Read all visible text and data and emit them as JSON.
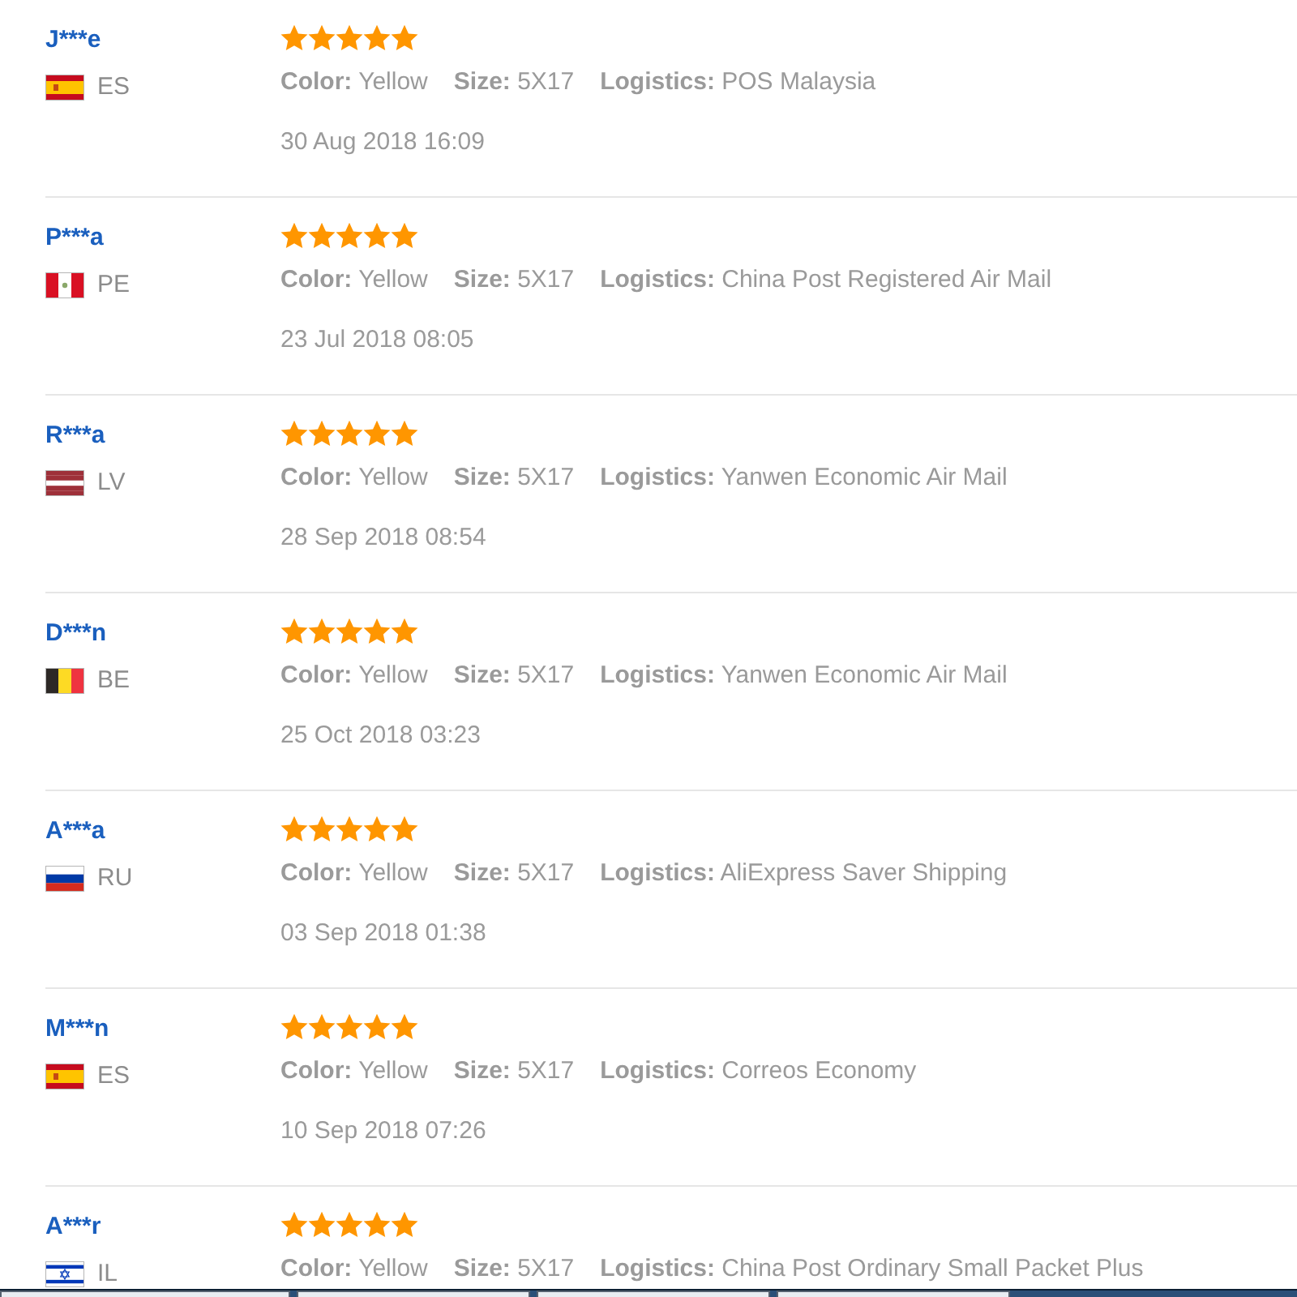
{
  "reviews": [
    {
      "name": "J***e",
      "country": "ES",
      "flag": {
        "kind": "spain"
      },
      "stars": 5,
      "attributes": [
        "**Color:** Yellow",
        "**Size:** 5X17",
        "**Logistics:** POS Malaysia"
      ],
      "date": "30 Aug 2018 16:09"
    },
    {
      "name": "P***a",
      "country": "PE",
      "flag": {
        "kind": "peru"
      },
      "stars": 5,
      "attributes": [
        "**Color:** Yellow",
        "**Size:** 5X17",
        "**Logistics:** China Post Registered Air Mail"
      ],
      "date": "23 Jul 2018 08:05"
    },
    {
      "name": "R***a",
      "country": "LV",
      "flag": {
        "kind": "latvia"
      },
      "stars": 5,
      "attributes": [
        "**Color:** Yellow",
        "**Size:** 5X17",
        "**Logistics:** Yanwen Economic Air Mail"
      ],
      "date": "28 Sep 2018 08:54"
    },
    {
      "name": "D***n",
      "country": "BE",
      "flag": {
        "kind": "belgium"
      },
      "stars": 5,
      "attributes": [
        "**Color:** Yellow",
        "**Size:** 5X17",
        "**Logistics:** Yanwen Economic Air Mail"
      ],
      "date": "25 Oct 2018 03:23"
    },
    {
      "name": "A***a",
      "country": "RU",
      "flag": {
        "kind": "russia"
      },
      "stars": 5,
      "attributes": [
        "**Color:** Yellow",
        "**Size:** 5X17",
        "**Logistics:** AliExpress Saver Shipping"
      ],
      "date": "03 Sep 2018 01:38"
    },
    {
      "name": "M***n",
      "country": "ES",
      "flag": {
        "kind": "spain"
      },
      "stars": 5,
      "attributes": [
        "**Color:** Yellow",
        "**Size:** 5X17",
        "**Logistics:** Correos Economy"
      ],
      "date": "10 Sep 2018 07:26"
    },
    {
      "name": "A***r",
      "country": "IL",
      "flag": {
        "kind": "israel"
      },
      "stars": 5,
      "attributes": [
        "**Color:** Yellow",
        "**Size:** 5X17",
        "**Logistics:** China Post Ordinary Small Packet Plus"
      ]
    }
  ]
}
